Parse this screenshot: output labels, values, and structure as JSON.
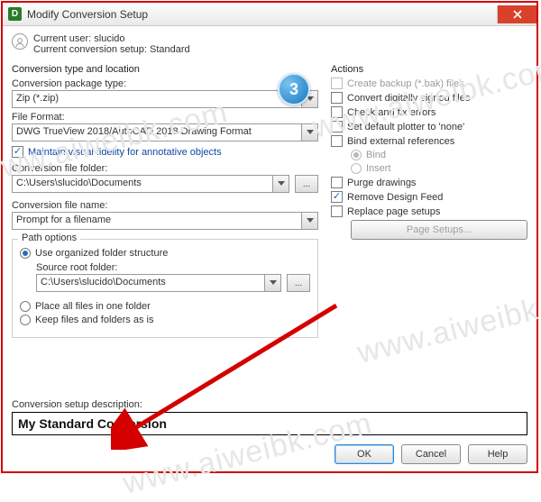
{
  "window": {
    "title": "Modify Conversion Setup",
    "app_icon_letter": "D"
  },
  "user": {
    "line1_label": "Current user:",
    "line1_value": "slucido",
    "line2_label": "Current conversion setup:",
    "line2_value": "Standard"
  },
  "step_badge": "3",
  "left_panel": {
    "section_label": "Conversion type and location",
    "package_label": "Conversion package type:",
    "package_value": "Zip (*.zip)",
    "fileformat_label": "File Format:",
    "fileformat_value": "DWG TrueView 2018/AutoCAD 2018 Drawing Format",
    "maintain_label": "Maintain visual fidelity for annotative objects",
    "folder_label": "Conversion file folder:",
    "folder_value": "C:\\Users\\slucido\\Documents",
    "browse_label": "...",
    "filename_label": "Conversion file name:",
    "filename_value": "Prompt for a filename"
  },
  "path_options": {
    "legend": "Path options",
    "opt_organized": "Use organized folder structure",
    "source_label": "Source root folder:",
    "source_value": "C:\\Users\\slucido\\Documents",
    "browse_label": "...",
    "opt_oneplace": "Place all files in one folder",
    "opt_keep": "Keep files and folders as is"
  },
  "actions": {
    "heading": "Actions",
    "create_backup": "Create backup (*.bak) files",
    "convert_signed": "Convert digitally signed files",
    "check_fix": "Check and fix errors",
    "default_plotter": "Set default plotter to 'none'",
    "bind_external": "Bind external references",
    "bind": "Bind",
    "insert": "Insert",
    "purge": "Purge drawings",
    "remove_feed": "Remove Design Feed",
    "replace_setups": "Replace page setups",
    "page_setups_btn": "Page Setups..."
  },
  "description": {
    "label": "Conversion setup description:",
    "value": "My Standard Conversion"
  },
  "buttons": {
    "ok": "OK",
    "cancel": "Cancel",
    "help": "Help"
  },
  "watermark": "www.aiweibk.com"
}
